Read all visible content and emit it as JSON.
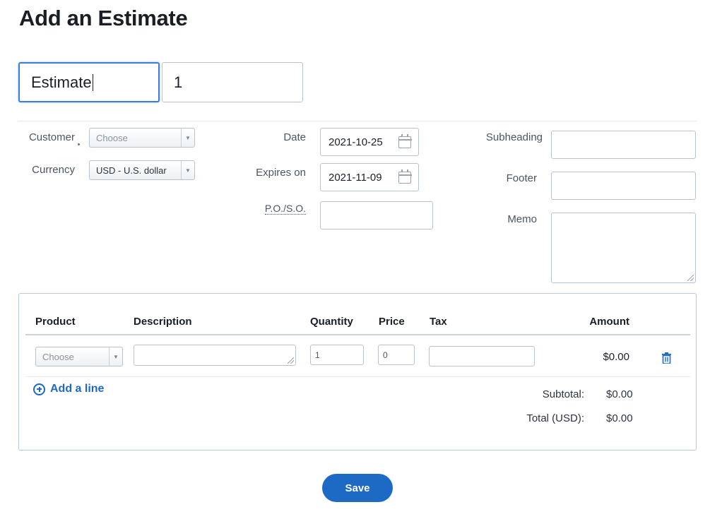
{
  "page_title": "Add an Estimate",
  "header": {
    "title_value": "Estimate",
    "number_value": "1"
  },
  "form": {
    "customer_label": "Customer",
    "customer_placeholder": "Choose",
    "currency_label": "Currency",
    "currency_value": "USD - U.S. dollar",
    "date_label": "Date",
    "date_value": "2021-10-25",
    "expires_label": "Expires on",
    "expires_value": "2021-11-09",
    "po_label": "P.O./S.O.",
    "subheading_label": "Subheading",
    "footer_label": "Footer",
    "memo_label": "Memo"
  },
  "items": {
    "columns": {
      "product": "Product",
      "description": "Description",
      "quantity": "Quantity",
      "price": "Price",
      "tax": "Tax",
      "amount": "Amount"
    },
    "rows": [
      {
        "product_placeholder": "Choose",
        "quantity": "1",
        "price": "0",
        "amount": "$0.00"
      }
    ],
    "add_line_label": "Add a line",
    "subtotal_label": "Subtotal:",
    "subtotal_value": "$0.00",
    "total_label": "Total (USD):",
    "total_value": "$0.00"
  },
  "save_label": "Save",
  "colors": {
    "accent": "#1c6ac4",
    "focus_border": "#3b7dd8"
  },
  "icons": [
    "calendar-icon",
    "trash-icon",
    "plus-circle-icon",
    "chevron-down-icon"
  ]
}
